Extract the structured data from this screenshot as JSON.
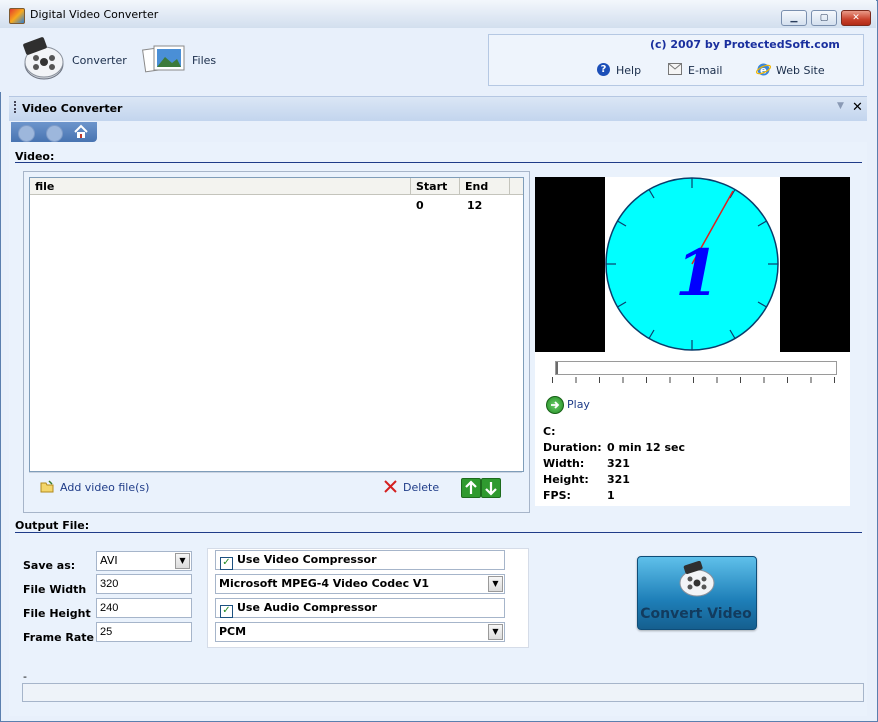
{
  "window": {
    "title": "Digital Video Converter"
  },
  "toolbar": {
    "converter_label": "Converter",
    "files_label": "Files"
  },
  "info": {
    "copyright": "(c) 2007 by ProtectedSoft.com",
    "help": "Help",
    "email": "E-mail",
    "website": "Web Site"
  },
  "panel": {
    "title": "Video Converter"
  },
  "video_section": {
    "label": "Video:",
    "columns": [
      "file",
      "Start",
      "End"
    ],
    "rows": [
      {
        "file": "",
        "start": "0",
        "end": "12"
      }
    ],
    "add_label": "Add video file(s)",
    "delete_label": "Delete"
  },
  "preview": {
    "clock_number": "1",
    "play_label": "Play",
    "file_label": "C:",
    "info": [
      {
        "label": "Duration:",
        "value": "0 min 12 sec"
      },
      {
        "label": "Width:",
        "value": "321"
      },
      {
        "label": "Height:",
        "value": "321"
      },
      {
        "label": "FPS:",
        "value": "1"
      }
    ]
  },
  "output": {
    "label": "Output File:",
    "save_as_label": "Save as:",
    "save_as_value": "AVI",
    "width_label": "File Width",
    "width_value": "320",
    "height_label": "File Height",
    "height_value": "240",
    "framerate_label": "Frame Rate",
    "framerate_value": "25",
    "use_video_compressor": "Use Video Compressor",
    "video_codec": "Microsoft MPEG-4 Video Codec V1",
    "use_audio_compressor": "Use Audio Compressor",
    "audio_codec": "PCM",
    "convert_label": "Convert Video"
  },
  "status": {
    "text": "-"
  },
  "colors": {
    "accent": "#1f3c88",
    "clock_face": "#00ffff",
    "hand_color": "#0000ff"
  }
}
